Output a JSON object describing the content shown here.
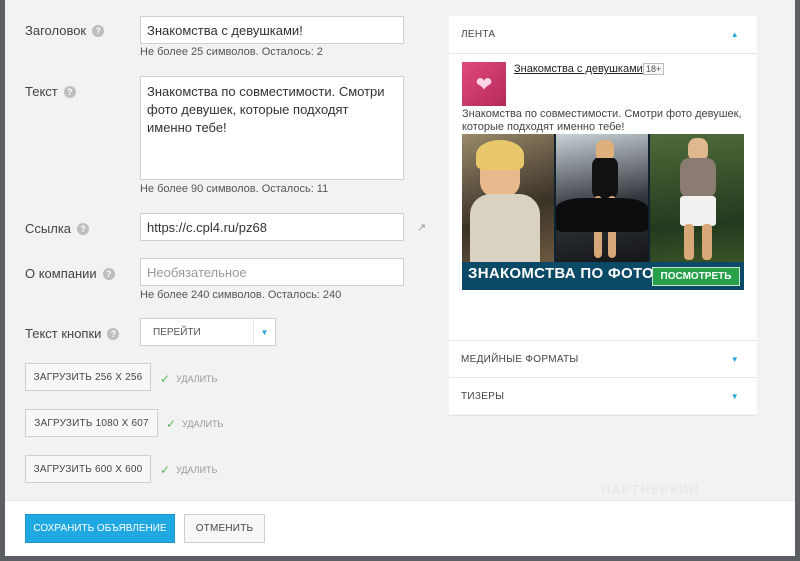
{
  "form": {
    "title_label": "Заголовок",
    "title_value": "Знакомства с девушками!",
    "title_hint": "Не более 25 символов. Осталось: 2",
    "text_label": "Текст",
    "text_value": "Знакомства по совместимости. Смотри фото девушек, которые подходят именно тебе!",
    "text_hint": "Не более 90 символов. Осталось: 11",
    "link_label": "Ссылка",
    "link_value": "https://c.cpl4.ru/pz68",
    "company_label": "О компании",
    "company_placeholder": "Необязательное",
    "company_hint": "Не более 240 символов. Осталось: 240",
    "button_text_label": "Текст кнопки",
    "button_text_value": "ПЕРЕЙТИ"
  },
  "uploads": [
    {
      "label": "ЗАГРУЗИТЬ 256 Х 256",
      "delete": "УДАЛИТЬ"
    },
    {
      "label": "ЗАГРУЗИТЬ 1080 Х 607",
      "delete": "УДАЛИТЬ"
    },
    {
      "label": "ЗАГРУЗИТЬ 600 Х 600",
      "delete": "УДАЛИТЬ"
    }
  ],
  "preview": {
    "sections": {
      "feed": "ЛЕНТА",
      "media": "МЕДИЙНЫЕ ФОРМАТЫ",
      "teasers": "ТИЗЕРЫ"
    },
    "ad_title": "Знакомства с девушками!",
    "age_badge": "18+",
    "ad_text": "Знакомства по совместимости. Смотри фото девушек, которые подходят именно тебе!",
    "banner_text": "ЗНАКОМСТВА ПО ФОТО",
    "banner_button": "ПОСМОТРЕТЬ"
  },
  "footer": {
    "save_label": "СОХРАНИТЬ ОБЪЯВЛЕНИЕ",
    "cancel_label": "ОТМЕНИТЬ",
    "watermark": "ПАРТНЕРКИН"
  },
  "colors": {
    "accent": "#1fa8e2",
    "banner_button": "#27a14a",
    "check": "#5cb85c"
  }
}
